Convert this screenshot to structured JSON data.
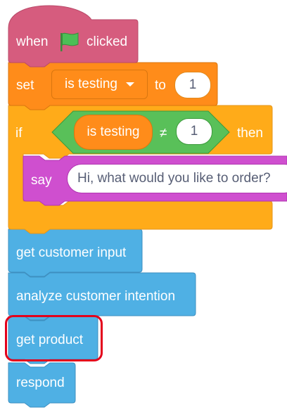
{
  "hat_block": {
    "when_label": "when",
    "flag_icon": "green-flag-icon",
    "clicked_label": "clicked"
  },
  "set_block": {
    "set_label": "set",
    "variable": "is testing",
    "to_label": "to",
    "value": "1"
  },
  "if_block": {
    "if_label": "if",
    "condition": {
      "left": "is testing",
      "operator": "≠",
      "right": "1"
    },
    "then_label": "then",
    "say_block": {
      "say_label": "say",
      "message": "Hi, what would you like to order?"
    }
  },
  "procedure_blocks": [
    {
      "label": "get customer input"
    },
    {
      "label": "analyze customer intention"
    },
    {
      "label": "get product",
      "highlighted": true
    },
    {
      "label": "respond"
    }
  ],
  "colors": {
    "events": "#d65c7e",
    "variables": "#ff8c1a",
    "control": "#ffab19",
    "operators": "#59c059",
    "looks": "#cf4fcf",
    "custom": "#4fb0e4",
    "highlight": "#e3001b"
  }
}
